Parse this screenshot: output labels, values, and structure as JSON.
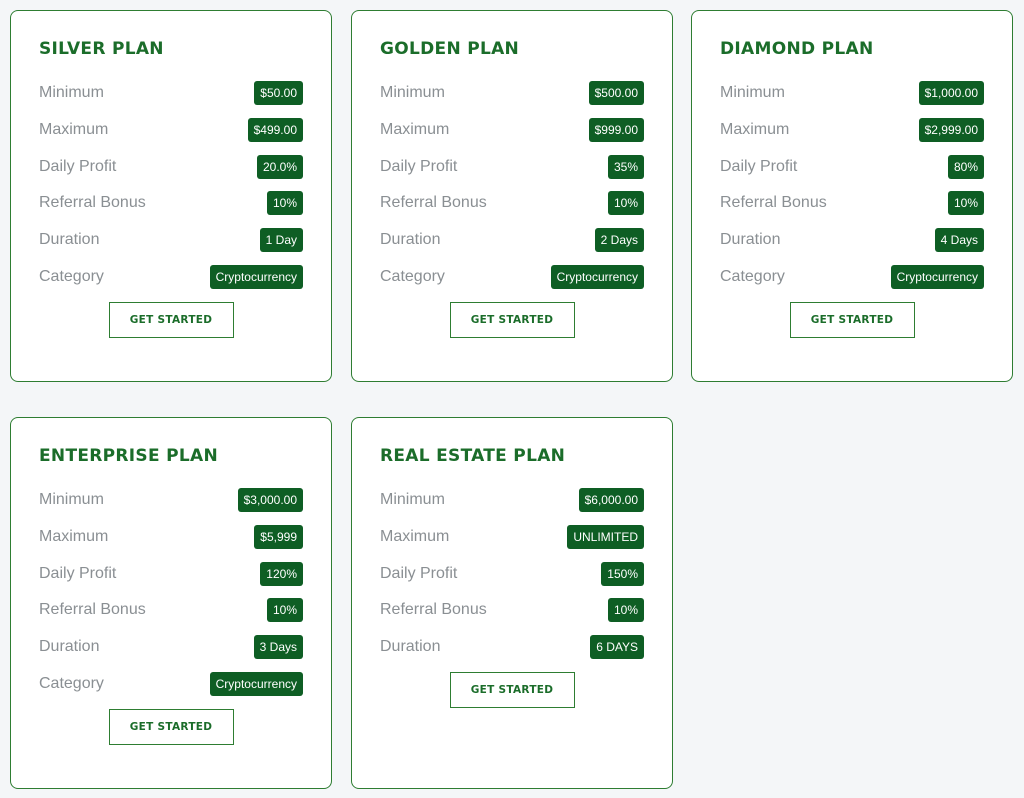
{
  "plans": [
    {
      "title": "SILVER PLAN",
      "rows": [
        {
          "label": "Minimum",
          "value": "$50.00"
        },
        {
          "label": "Maximum",
          "value": "$499.00"
        },
        {
          "label": "Daily Profit",
          "value": "20.0%"
        },
        {
          "label": "Referral Bonus",
          "value": "10%"
        },
        {
          "label": "Duration",
          "value": "1 Day"
        },
        {
          "label": "Category",
          "value": "Cryptocurrency"
        }
      ],
      "button": "GET STARTED"
    },
    {
      "title": "GOLDEN PLAN",
      "rows": [
        {
          "label": "Minimum",
          "value": "$500.00"
        },
        {
          "label": "Maximum",
          "value": "$999.00"
        },
        {
          "label": "Daily Profit",
          "value": "35%"
        },
        {
          "label": "Referral Bonus",
          "value": "10%"
        },
        {
          "label": "Duration",
          "value": "2 Days"
        },
        {
          "label": "Category",
          "value": "Cryptocurrency"
        }
      ],
      "button": "GET STARTED"
    },
    {
      "title": "DIAMOND PLAN",
      "rows": [
        {
          "label": "Minimum",
          "value": "$1,000.00"
        },
        {
          "label": "Maximum",
          "value": "$2,999.00"
        },
        {
          "label": "Daily Profit",
          "value": "80%"
        },
        {
          "label": "Referral Bonus",
          "value": "10%"
        },
        {
          "label": "Duration",
          "value": "4 Days"
        },
        {
          "label": "Category",
          "value": "Cryptocurrency"
        }
      ],
      "button": "GET STARTED"
    },
    {
      "title": "ENTERPRISE PLAN",
      "rows": [
        {
          "label": "Minimum",
          "value": "$3,000.00"
        },
        {
          "label": "Maximum",
          "value": "$5,999"
        },
        {
          "label": "Daily Profit",
          "value": "120%"
        },
        {
          "label": "Referral Bonus",
          "value": "10%"
        },
        {
          "label": "Duration",
          "value": "3 Days"
        },
        {
          "label": "Category",
          "value": "Cryptocurrency"
        }
      ],
      "button": "GET STARTED"
    },
    {
      "title": "REAL ESTATE PLAN",
      "rows": [
        {
          "label": "Minimum",
          "value": "$6,000.00"
        },
        {
          "label": "Maximum",
          "value": "UNLIMITED"
        },
        {
          "label": "Daily Profit",
          "value": "150%"
        },
        {
          "label": "Referral Bonus",
          "value": "10%"
        },
        {
          "label": "Duration",
          "value": "6 DAYS"
        }
      ],
      "button": "GET STARTED"
    }
  ],
  "colors": {
    "accent": "#1b6d2a",
    "badge": "#0e5e24",
    "border": "#2e7d32",
    "label": "#8a8f93",
    "background": "#f4f6f8"
  }
}
